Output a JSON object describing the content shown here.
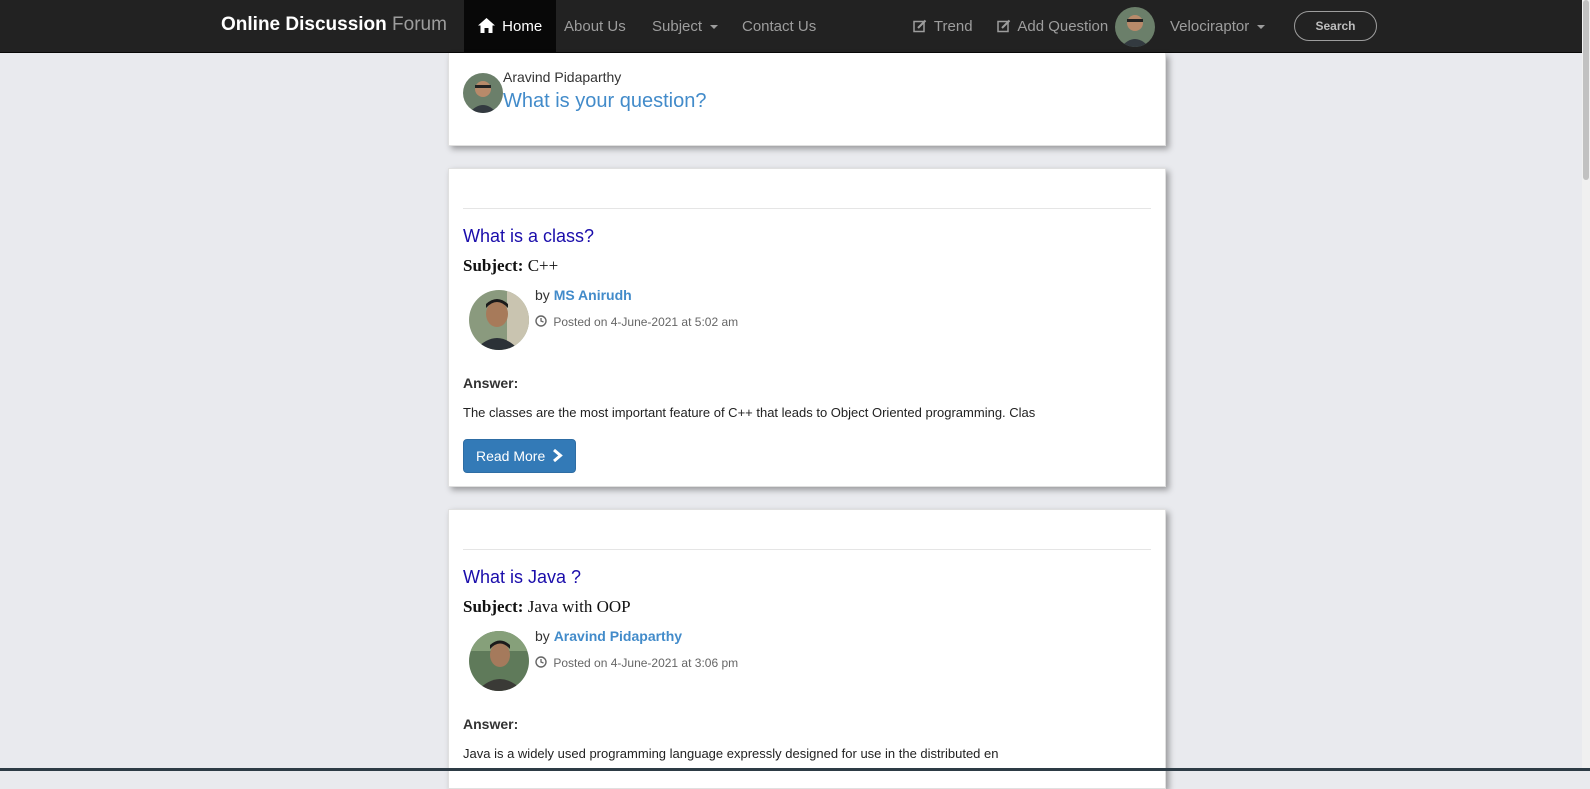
{
  "navbar": {
    "brand_bold": "Online Discussion",
    "brand_light": "Forum",
    "home": "Home",
    "about": "About Us",
    "subject": "Subject",
    "contact": "Contact Us",
    "trend": "Trend",
    "add_question": "Add Question",
    "username": "Velociraptor",
    "search": "Search"
  },
  "ask_box": {
    "user": "Aravind Pidaparthy",
    "prompt": "What is your question?"
  },
  "questions": [
    {
      "title": "What is a class?",
      "subject_label": "Subject:",
      "subject": "C++",
      "by_label": "by",
      "author": "MS Anirudh",
      "posted": "Posted on 4-June-2021 at 5:02 am",
      "answer_label": "Answer:",
      "answer": "The classes are the most important feature of C++ that leads to Object Oriented programming. Clas",
      "read_more": "Read More"
    },
    {
      "title": "What is Java ?",
      "subject_label": "Subject:",
      "subject": "Java with OOP",
      "by_label": "by",
      "author": "Aravind Pidaparthy",
      "posted": "Posted on 4-June-2021 at 3:06 pm",
      "answer_label": "Answer:",
      "answer": " Java is a widely used programming language expressly designed for use in the distributed en"
    }
  ],
  "colors": {
    "navbar_bg": "#222222",
    "link_blue": "#428bca",
    "title_blue": "#1a0dab",
    "button_blue": "#337ab7",
    "page_bg": "#e9eaee"
  }
}
